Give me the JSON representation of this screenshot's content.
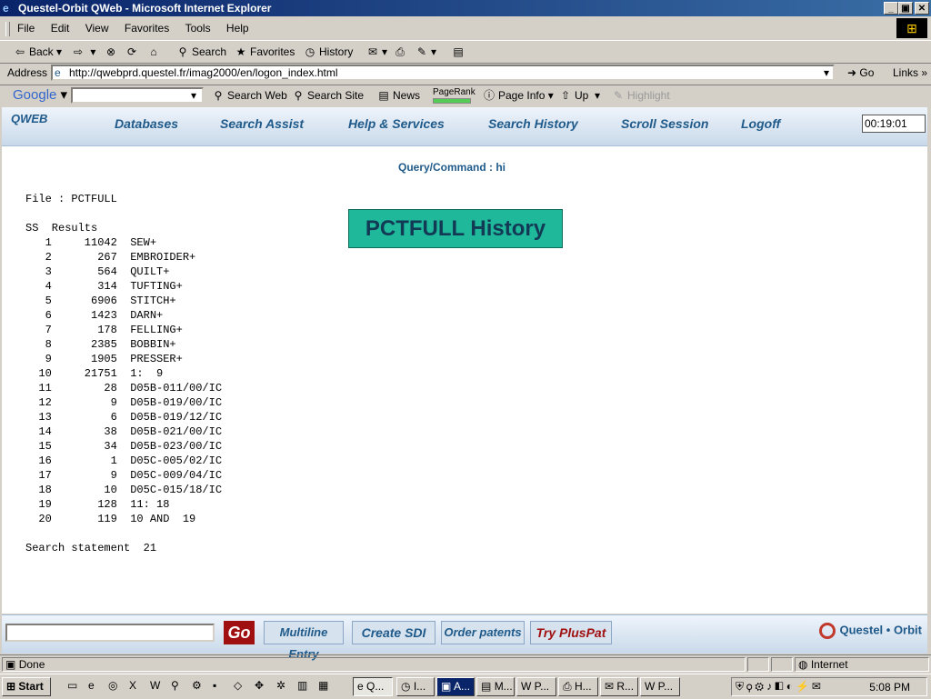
{
  "window": {
    "title": "Questel-Orbit QWeb - Microsoft Internet Explorer",
    "minimize": "_",
    "maximize": "▣",
    "close": "✕"
  },
  "menu": [
    "File",
    "Edit",
    "View",
    "Favorites",
    "Tools",
    "Help"
  ],
  "toolbar": {
    "back": "Back",
    "search": "Search",
    "favorites": "Favorites",
    "history": "History"
  },
  "address": {
    "label": "Address",
    "url": "http://qwebprd.questel.fr/imag2000/en/logon_index.html",
    "go": "Go",
    "links": "Links"
  },
  "google": {
    "logo": "Google",
    "search_web": "Search Web",
    "search_site": "Search Site",
    "news": "News",
    "pagerank": "PageRank",
    "page_info": "Page Info",
    "up": "Up",
    "highlight": "Highlight"
  },
  "qweb": {
    "logo": "QWEB",
    "nav": [
      "Databases",
      "Search Assist",
      "Help & Services",
      "Search History",
      "Scroll Session",
      "Logoff"
    ],
    "timer": "00:19:01"
  },
  "content": {
    "query": "Query/Command : hi",
    "file": "File : PCTFULL",
    "results_header": "SS  Results",
    "history_box": "PCTFULL History",
    "rows": [
      {
        "ss": "1",
        "count": "11042",
        "term": "SEW+"
      },
      {
        "ss": "2",
        "count": "267",
        "term": "EMBROIDER+"
      },
      {
        "ss": "3",
        "count": "564",
        "term": "QUILT+"
      },
      {
        "ss": "4",
        "count": "314",
        "term": "TUFTING+"
      },
      {
        "ss": "5",
        "count": "6906",
        "term": "STITCH+"
      },
      {
        "ss": "6",
        "count": "1423",
        "term": "DARN+"
      },
      {
        "ss": "7",
        "count": "178",
        "term": "FELLING+"
      },
      {
        "ss": "8",
        "count": "2385",
        "term": "BOBBIN+"
      },
      {
        "ss": "9",
        "count": "1905",
        "term": "PRESSER+"
      },
      {
        "ss": "10",
        "count": "21751",
        "term": "1:  9"
      },
      {
        "ss": "11",
        "count": "28",
        "term": "D05B-011/00/IC"
      },
      {
        "ss": "12",
        "count": "9",
        "term": "D05B-019/00/IC"
      },
      {
        "ss": "13",
        "count": "6",
        "term": "D05B-019/12/IC"
      },
      {
        "ss": "14",
        "count": "38",
        "term": "D05B-021/00/IC"
      },
      {
        "ss": "15",
        "count": "34",
        "term": "D05B-023/00/IC"
      },
      {
        "ss": "16",
        "count": "1",
        "term": "D05C-005/02/IC"
      },
      {
        "ss": "17",
        "count": "9",
        "term": "D05C-009/04/IC"
      },
      {
        "ss": "18",
        "count": "10",
        "term": "D05C-015/18/IC"
      },
      {
        "ss": "19",
        "count": "128",
        "term": "11: 18"
      },
      {
        "ss": "20",
        "count": "119",
        "term": "10 AND  19"
      }
    ],
    "search_statement": "Search statement  21"
  },
  "bottom": {
    "go": "Go",
    "multiline": "Multiline Entry",
    "create_sdi": "Create SDI",
    "order_patents": "Order patents",
    "try": "Try ",
    "pluspat": "PlusPat",
    "brand": "Questel • Orbit"
  },
  "status": {
    "text": "Done",
    "zone": "Internet"
  },
  "taskbar": {
    "start": "Start",
    "tasks": [
      "Q...",
      "I...",
      "A...",
      "M...",
      "P...",
      "H...",
      "R...",
      "P..."
    ],
    "clock": "5:08 PM"
  }
}
